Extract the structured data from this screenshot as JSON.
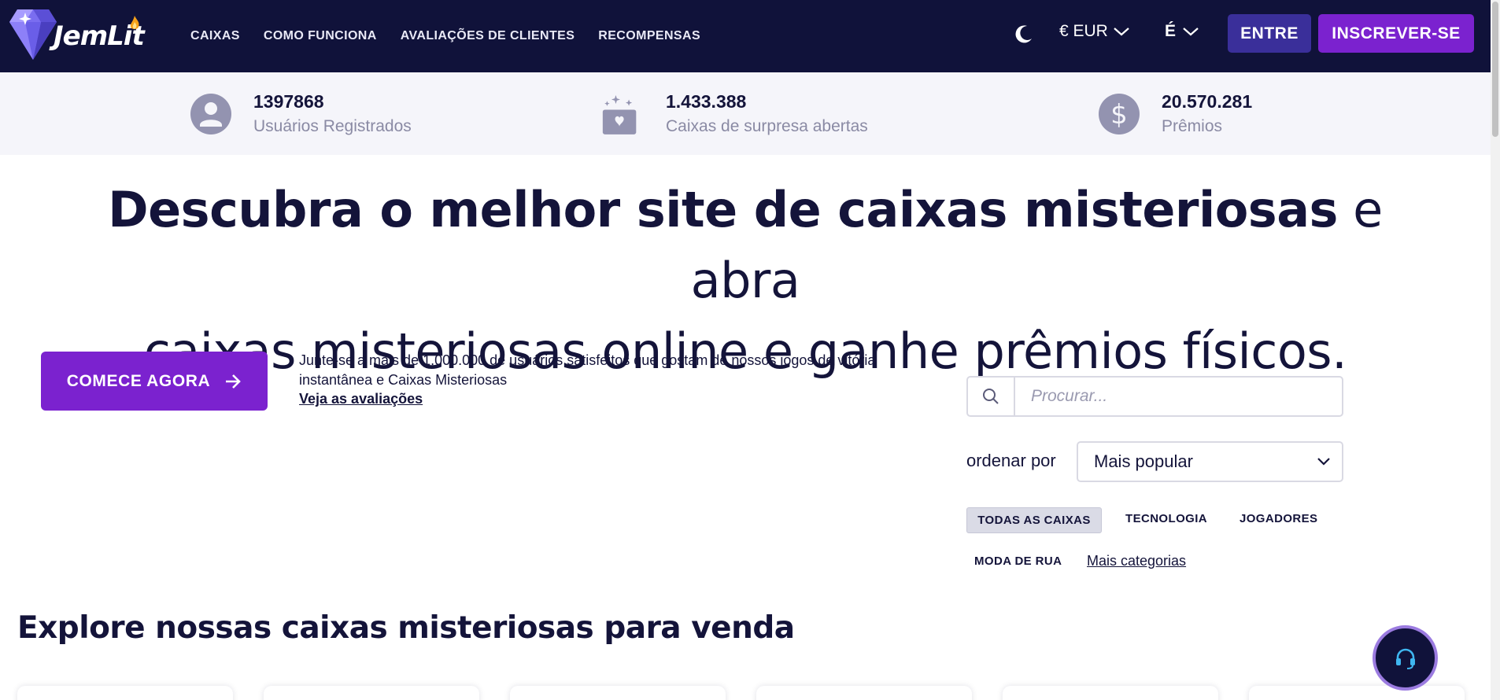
{
  "brand": {
    "name": "JemLit"
  },
  "nav": {
    "links": [
      "CAIXAS",
      "COMO FUNCIONA",
      "AVALIAÇÕES DE CLIENTES",
      "RECOMPENSAS"
    ],
    "currency": "€ EUR",
    "language": "É",
    "login": "ENTRE",
    "signup": "INSCREVER-SE"
  },
  "stats": [
    {
      "value": "1397868",
      "label": "Usuários Registrados",
      "icon": "user-icon"
    },
    {
      "value": "1.433.388",
      "label": "Caixas de surpresa abertas",
      "icon": "gift-box-icon"
    },
    {
      "value": "20.570.281",
      "label": "Prêmios",
      "icon": "dollar-icon"
    }
  ],
  "hero": {
    "bold": "Descubra o melhor site de caixas misteriosas",
    "rest_line1": " e abra",
    "line2": "caixas misteriosas online e ganhe prêmios físicos."
  },
  "cta": {
    "button": "COMECE AGORA",
    "text": "Junte-se a mais de 1.000.000 de usuários satisfeitos que gostam de nossos jogos de vitória instantânea e Caixas Misteriosas",
    "link": "Veja as avaliações"
  },
  "search": {
    "placeholder": "Procurar..."
  },
  "sort": {
    "label": "ordenar por",
    "selected": "Mais popular"
  },
  "categories": {
    "items": [
      "TODAS AS CAIXAS",
      "TECNOLOGIA",
      "JOGADORES",
      "MODA DE RUA"
    ],
    "more": "Mais categorias"
  },
  "section": {
    "title": "Explore nossas caixas misteriosas para venda"
  },
  "colors": {
    "nav_bg": "#10123a",
    "accent": "#7b22cf",
    "login_bg": "#3a2f9a",
    "stats_bg": "#f5f5fa"
  }
}
